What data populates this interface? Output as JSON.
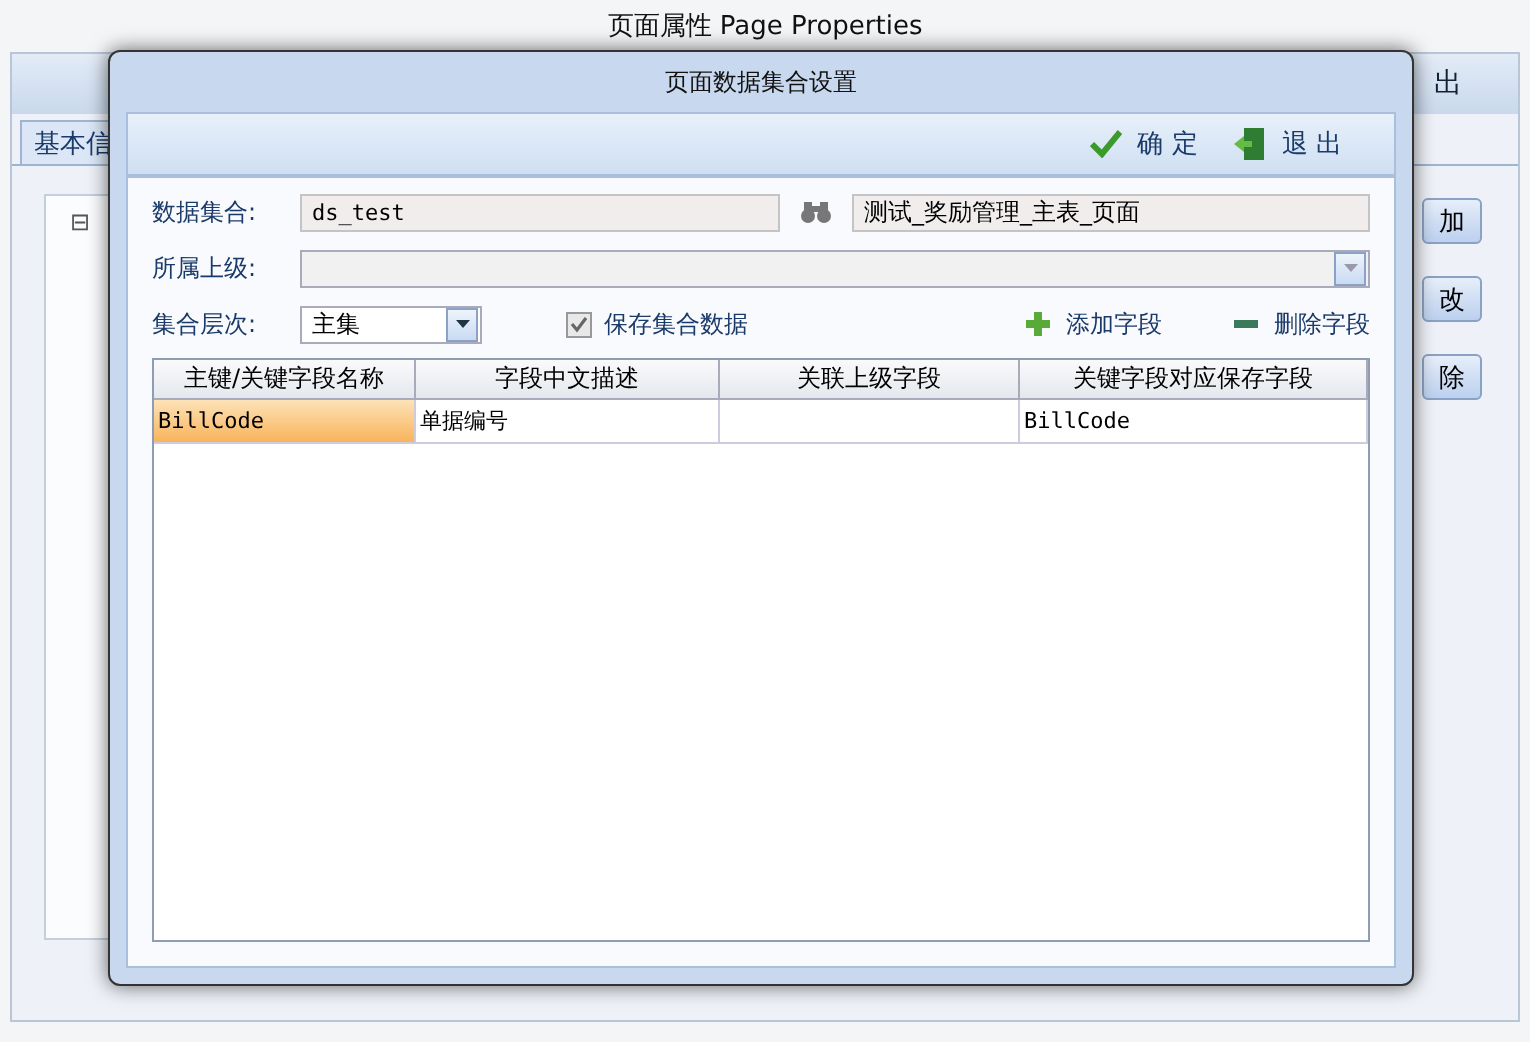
{
  "background_window": {
    "title": "页面属性  Page Properties",
    "toolbar_button": "出",
    "tab": {
      "label": "基本信",
      "selected": true
    },
    "tree_toggle": "⊟",
    "side_buttons": [
      "加",
      "改",
      "除"
    ]
  },
  "dialog": {
    "title": "页面数据集合设置",
    "toolbar": [
      {
        "kind": "confirm",
        "label": "确 定"
      },
      {
        "kind": "exit",
        "label": "退 出"
      }
    ],
    "dataset": {
      "label": "数据集合:",
      "value": "ds_test",
      "description": "测试_奖励管理_主表_页面"
    },
    "parent": {
      "label": "所属上级:"
    },
    "level": {
      "label": "集合层次:",
      "value": "主集"
    },
    "save_data": {
      "label": "保存集合数据",
      "checked": true
    },
    "actions": [
      {
        "kind": "add",
        "label": "添加字段"
      },
      {
        "kind": "remove",
        "label": "删除字段"
      }
    ],
    "table": {
      "columns": [
        "主键/关键字段名称",
        "字段中文描述",
        "关联上级字段",
        "关键字段对应保存字段"
      ],
      "rows": [
        {
          "cells": [
            "BillCode",
            "单据编号",
            null,
            "BillCode"
          ],
          "selected": true
        }
      ]
    }
  }
}
